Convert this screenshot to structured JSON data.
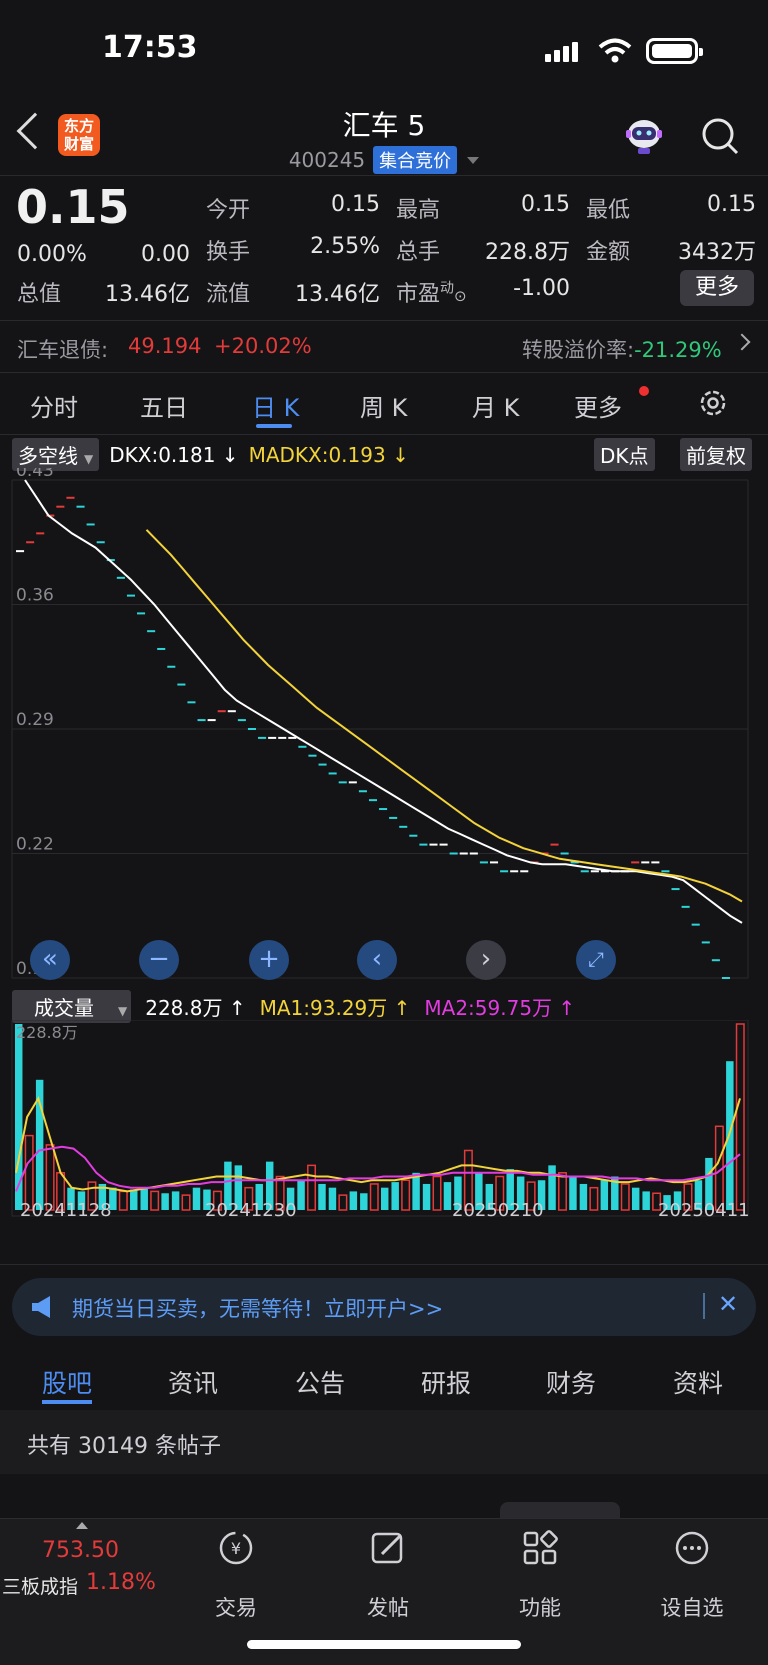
{
  "status": {
    "time": "17:53"
  },
  "header": {
    "title": "汇车 5",
    "code": "400245",
    "badge": "集合竞价",
    "logo_line1": "东方",
    "logo_line2": "财富"
  },
  "quote": {
    "price": "0.15",
    "change_pct": "0.00%",
    "change_abs": "0.00",
    "items": [
      {
        "label": "今开",
        "value": "0.15"
      },
      {
        "label": "最高",
        "value": "0.15"
      },
      {
        "label": "最低",
        "value": "0.15"
      },
      {
        "label": "换手",
        "value": "2.55%"
      },
      {
        "label": "总手",
        "value": "228.8万"
      },
      {
        "label": "金额",
        "value": "3432万"
      },
      {
        "label": "总值",
        "value": "13.46亿"
      },
      {
        "label": "流值",
        "value": "13.46亿"
      },
      {
        "label": "市盈",
        "value": "-1.00"
      }
    ],
    "pe_sup": "动",
    "more": "更多"
  },
  "bond": {
    "label": "汇车退债:",
    "price": "49.194",
    "change": "+20.02%",
    "premium_label": "转股溢价率:",
    "premium": "-21.29%"
  },
  "tabs": [
    "分时",
    "五日",
    "日 K",
    "周 K",
    "月 K",
    "更多"
  ],
  "chart_toolbar": {
    "indicator_select": "多空线",
    "dkx": "DKX:0.181 ↓",
    "madkx": "MADKX:0.193 ↓",
    "dk_btn": "DK点",
    "adjust_btn": "前复权"
  },
  "volume_toolbar": {
    "select": "成交量",
    "vol": "228.8万 ↑",
    "ma1": "MA1:93.29万 ↑",
    "ma2": "MA2:59.75万 ↑",
    "max_label": "228.8万"
  },
  "colors": {
    "up": "#e33a3a",
    "down": "#2dd4d8",
    "dkx": "#ffffff",
    "madkx": "#f3d33a",
    "ma1": "#f3d33a",
    "ma2": "#e23ce0",
    "accent": "#4d8cf0"
  },
  "chart_data": {
    "type": "line",
    "ylim": [
      0.15,
      0.43
    ],
    "yticks": [
      "0.43",
      "0.36",
      "0.29",
      "0.22",
      "0.15"
    ],
    "xticks": [
      "20241128",
      "20241230",
      "20250210",
      "20250411"
    ],
    "candles": [
      0.39,
      0.395,
      0.4,
      0.41,
      0.415,
      0.42,
      0.415,
      0.405,
      0.395,
      0.385,
      0.375,
      0.365,
      0.355,
      0.345,
      0.335,
      0.325,
      0.315,
      0.305,
      0.295,
      0.295,
      0.3,
      0.3,
      0.295,
      0.29,
      0.285,
      0.285,
      0.285,
      0.285,
      0.28,
      0.275,
      0.27,
      0.265,
      0.26,
      0.26,
      0.255,
      0.25,
      0.245,
      0.24,
      0.235,
      0.23,
      0.225,
      0.225,
      0.225,
      0.22,
      0.22,
      0.22,
      0.215,
      0.215,
      0.21,
      0.21,
      0.21,
      0.215,
      0.22,
      0.225,
      0.22,
      0.215,
      0.21,
      0.21,
      0.21,
      0.21,
      0.21,
      0.215,
      0.215,
      0.215,
      0.21,
      0.2,
      0.19,
      0.18,
      0.17,
      0.16,
      0.15
    ],
    "dkx": [
      0.43,
      0.42,
      0.41,
      0.405,
      0.4,
      0.396,
      0.392,
      0.386,
      0.38,
      0.374,
      0.367,
      0.36,
      0.352,
      0.344,
      0.336,
      0.328,
      0.32,
      0.312,
      0.306,
      0.302,
      0.298,
      0.294,
      0.29,
      0.286,
      0.282,
      0.278,
      0.274,
      0.27,
      0.266,
      0.262,
      0.258,
      0.254,
      0.25,
      0.246,
      0.242,
      0.238,
      0.234,
      0.231,
      0.228,
      0.225,
      0.222,
      0.219,
      0.217,
      0.215,
      0.214,
      0.214,
      0.214,
      0.213,
      0.212,
      0.211,
      0.21,
      0.21,
      0.21,
      0.209,
      0.208,
      0.207,
      0.205,
      0.2,
      0.195,
      0.19,
      0.185,
      0.181
    ],
    "madkx": [
      null,
      null,
      null,
      null,
      null,
      null,
      null,
      null,
      null,
      null,
      0.402,
      0.395,
      0.388,
      0.38,
      0.372,
      0.364,
      0.356,
      0.348,
      0.34,
      0.333,
      0.326,
      0.32,
      0.314,
      0.308,
      0.302,
      0.297,
      0.292,
      0.287,
      0.282,
      0.277,
      0.272,
      0.267,
      0.262,
      0.257,
      0.252,
      0.247,
      0.242,
      0.237,
      0.233,
      0.229,
      0.226,
      0.223,
      0.221,
      0.219,
      0.217,
      0.216,
      0.215,
      0.214,
      0.213,
      0.212,
      0.211,
      0.21,
      0.209,
      0.208,
      0.207,
      0.205,
      0.203,
      0.2,
      0.197,
      0.193
    ],
    "volumes": [
      100,
      40,
      70,
      35,
      20,
      12,
      10,
      15,
      14,
      12,
      10,
      11,
      12,
      10,
      9,
      10,
      8,
      12,
      11,
      10,
      26,
      24,
      12,
      14,
      26,
      18,
      12,
      16,
      24,
      14,
      12,
      8,
      10,
      9,
      14,
      12,
      15,
      16,
      20,
      14,
      18,
      15,
      18,
      32,
      20,
      14,
      18,
      22,
      18,
      15,
      16,
      24,
      20,
      18,
      14,
      12,
      16,
      18,
      14,
      12,
      10,
      9,
      8,
      10,
      14,
      16,
      28,
      45,
      80,
      100
    ],
    "ma1": [
      20,
      50,
      60,
      40,
      20,
      12,
      11,
      12,
      12,
      11,
      10,
      11,
      12,
      13,
      14,
      15,
      16,
      17,
      18,
      18,
      18,
      17,
      16,
      16,
      17,
      18,
      19,
      18,
      18,
      17,
      16,
      15,
      16,
      16,
      16,
      17,
      18,
      19,
      20,
      22,
      24,
      24,
      23,
      22,
      21,
      21,
      20,
      20,
      19,
      18,
      18,
      18,
      17,
      16,
      15,
      15,
      16,
      17,
      16,
      15,
      15,
      16,
      18,
      25,
      40,
      60
    ],
    "ma2": [
      10,
      25,
      32,
      33,
      34,
      33,
      28,
      20,
      15,
      13,
      12,
      12,
      12,
      13,
      13,
      14,
      14,
      15,
      15,
      16,
      16,
      16,
      16,
      16,
      16,
      16,
      16,
      16,
      16,
      17,
      17,
      17,
      18,
      18,
      18,
      19,
      19,
      19,
      20,
      20,
      20,
      20,
      20,
      20,
      20,
      19,
      19,
      19,
      18,
      18,
      18,
      18,
      17,
      17,
      17,
      16,
      16,
      16,
      16,
      17,
      18,
      20,
      25,
      30
    ]
  },
  "ad": {
    "text": "期货当日买卖，无需等待！立即开户>>"
  },
  "sub_tabs": [
    "股吧",
    "资讯",
    "公告",
    "研报",
    "财务",
    "资料"
  ],
  "posts_count": "共有 30149 条帖子",
  "bottom_nav": {
    "index_value": "753.50",
    "index_name": "三板成指",
    "index_change": "1.18%",
    "items": [
      "交易",
      "发帖",
      "功能",
      "设自选"
    ]
  }
}
